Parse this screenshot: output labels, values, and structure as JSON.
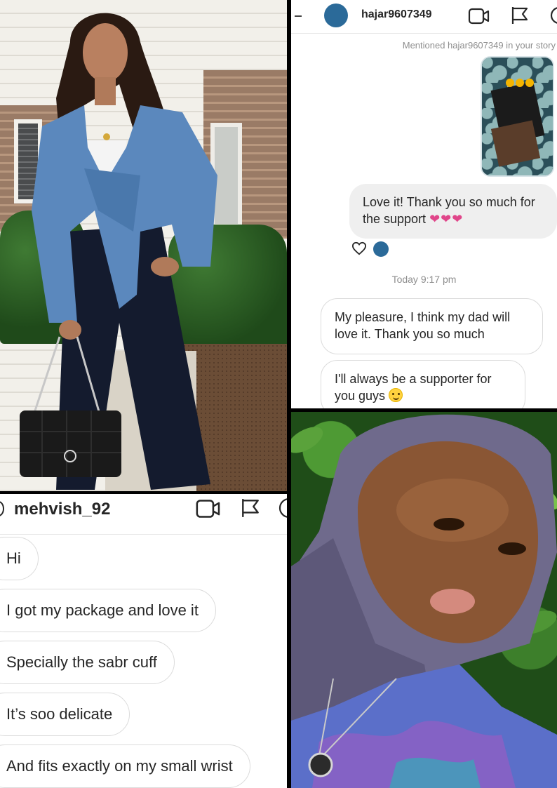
{
  "chat1": {
    "username": "hajar9607349",
    "mention_notice": "Mentioned hajar9607349 in your story",
    "messages": [
      {
        "text": "Love it! Thank you so much for the support",
        "suffix": "❤❤❤"
      },
      {
        "text": "My pleasure, I think my dad will love it. Thank you so much"
      },
      {
        "text": "I'll always be a supporter for you guys"
      }
    ],
    "timestamp": "Today 9:17 pm"
  },
  "chat2": {
    "username": "mehvish_92",
    "messages": [
      "Hi",
      "I got my package and love it",
      "Specially the sabr cuff",
      "It’s soo delicate",
      "And fits exactly on my small wrist"
    ]
  },
  "icons": {
    "video": "video-camera-icon",
    "flag": "flag-icon",
    "info": "info-icon",
    "heart": "heart-outline-icon",
    "smiley": "smiling-face-emoji"
  },
  "colors": {
    "avatar": "#2b6a99",
    "heart": "#e0468a",
    "divider": "#000000"
  }
}
